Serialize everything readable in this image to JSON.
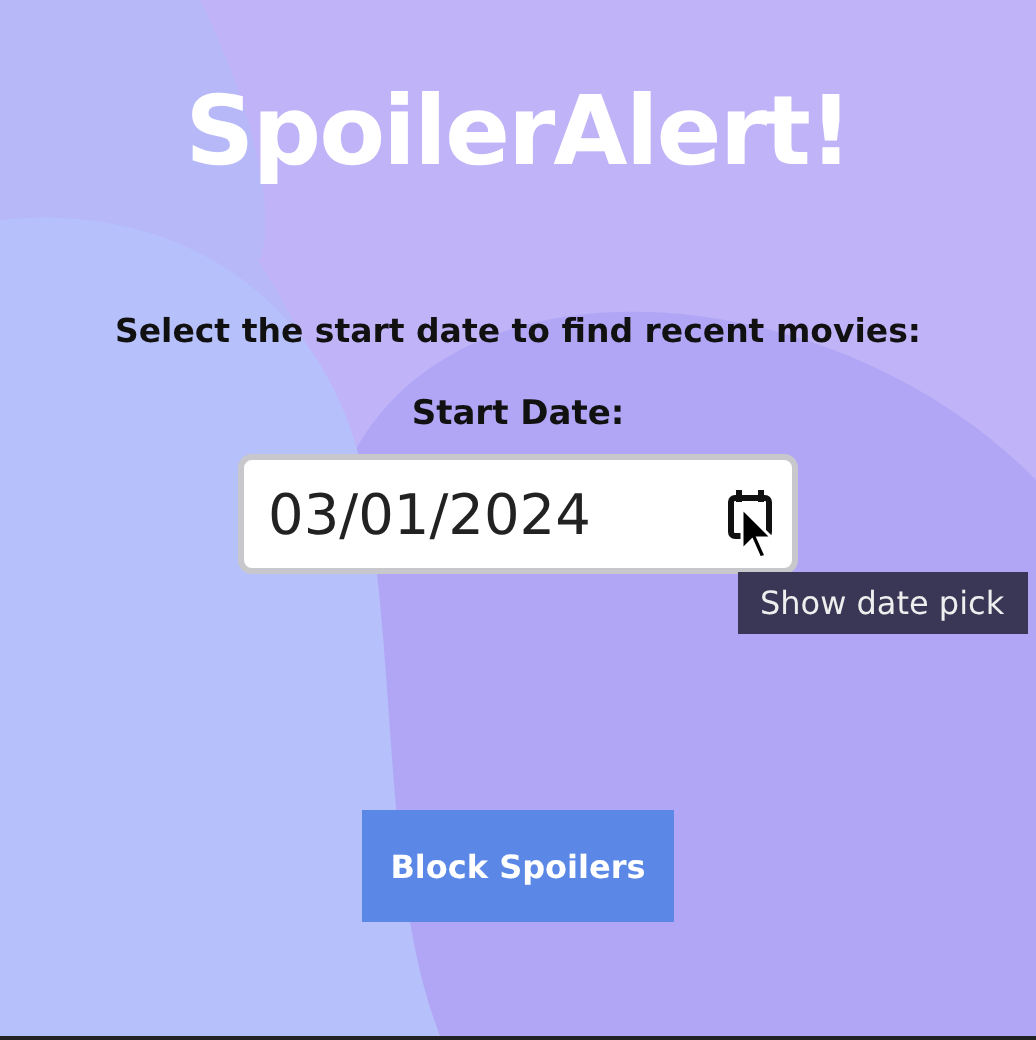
{
  "title": "SpoilerAlert!",
  "prompt": "Select the start date to find recent movies:",
  "date_field": {
    "label": "Start Date:",
    "value": "03/01/2024"
  },
  "tooltip": "Show date pick",
  "buttons": [
    "Block Spoilers"
  ]
}
